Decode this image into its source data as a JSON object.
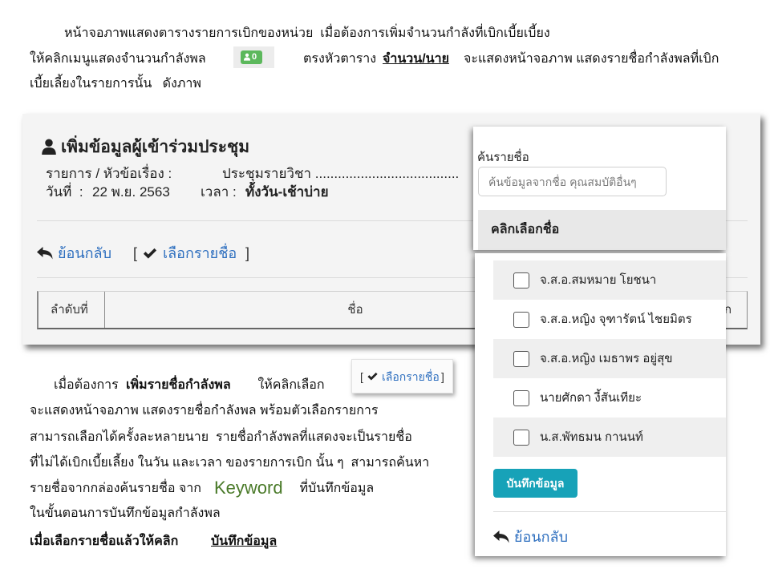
{
  "intro": {
    "line1": "หน้าจอภาพแสดงตารางรายการเบิกของหน่วย  เมื่อต้องการเพิ่มจำนวนกำลังที่เบิกเบี้ยเบี้ยง",
    "line2_start": "ให้คลิกเมนูแสดงจำนวนกำลังพล",
    "badge": {
      "icon": "user-icon",
      "count": "0"
    },
    "line2_mid": "ตรงหัวตาราง",
    "line2_emphasis": "จำนวน/นาย",
    "line2_end": "จะแสดงหน้าจอภาพ แสดงรายชื่อกำลังพลที่เบิก",
    "line3": "เบี้ยเลี้ยงในรายการนั้น   ดังภาพ"
  },
  "form_screen": {
    "title_icon": "user-icon",
    "title": "เพิ่มข้อมูลผู้เข้าร่วมประชุม",
    "topic_label": "รายการ / หัวข้อเรื่อง :",
    "topic_value": "ประชุมรายวิชา ......................................",
    "date_label": "วันที่  :",
    "date_value": "22 พ.ย. 2563",
    "time_label": "เวลา :",
    "time_value": "ทั้งวัน-เช้าบ่าย",
    "back": {
      "icon": "reply-icon",
      "label": "ย้อนกลับ"
    },
    "select_names": {
      "open_bracket": "[",
      "icon": "check-icon",
      "label": "เลือกรายชื่อ",
      "close_bracket": "]"
    },
    "table_headers": [
      "ลำดับที่",
      "ชื่อ",
      "ก"
    ]
  },
  "search_panel": {
    "label": "ค้นรายชื่อ",
    "placeholder": "ค้นข้อมูลจากชื่อ คุณสมบัติอื่นๆ",
    "value": "",
    "list_heading": "คลิกเลือกชื่อ"
  },
  "name_list": {
    "items": [
      {
        "name": "จ.ส.อ.สมหมาย โยชนา",
        "checked": false
      },
      {
        "name": "จ.ส.อ.หญิง จุฑารัตน์ ไชยมิตร",
        "checked": false
      },
      {
        "name": "จ.ส.อ.หญิง เมธาพร อยู่สุข",
        "checked": false
      },
      {
        "name": "นายศักดา งี้สันเทียะ",
        "checked": false
      },
      {
        "name": "น.ส.พัทธมน กานนท์",
        "checked": false
      }
    ],
    "save_label": "บันทึกข้อมูล",
    "back": {
      "icon": "reply-icon",
      "label": "ย้อนกลับ"
    }
  },
  "select_button_sample": {
    "open_bracket": "[",
    "icon": "check-icon",
    "label": "เลือกรายชื่อ",
    "close_bracket": "]"
  },
  "instructions": {
    "line1_start": "เมื่อต้องการ ",
    "line1_bold": "เพิ่มรายชื่อกำลังพล",
    "line1_end": " ให้คลิกเลือก",
    "line2": "จะแสดงหน้าจอภาพ แสดงรายชื่อกำลังพล พร้อมตัวเลือกรายการ",
    "line3": "สามารถเลือกได้ครั้งละหลายนาย  รายชื่อกำลังพลที่แสดงจะเป็นรายชื่อ",
    "line4": "ที่ไม่ได้เบิกเบี้ยเลี้ยง ในวัน และเวลา ของรายการเบิก นั้น ๆ  สามารถค้นหา",
    "line5_start": "รายชื่อจากกล่องค้นรายชื่อ จาก ",
    "line5_keyword": "Keyword",
    "line5_end": " ที่บันทึกข้อมูล",
    "line6": "ในขั้นตอนการบันทึกข้อมูลกำลังพล",
    "line7_start": "เมื่อเลือกรายชื่อแล้วให้คลิก ",
    "line7_link": "บันทึกข้อมูล"
  },
  "colors": {
    "link_blue": "#2e6fbf",
    "save_teal": "#17a2b8",
    "badge_green": "#5cb85c",
    "keyword_green": "#4a7a29"
  }
}
